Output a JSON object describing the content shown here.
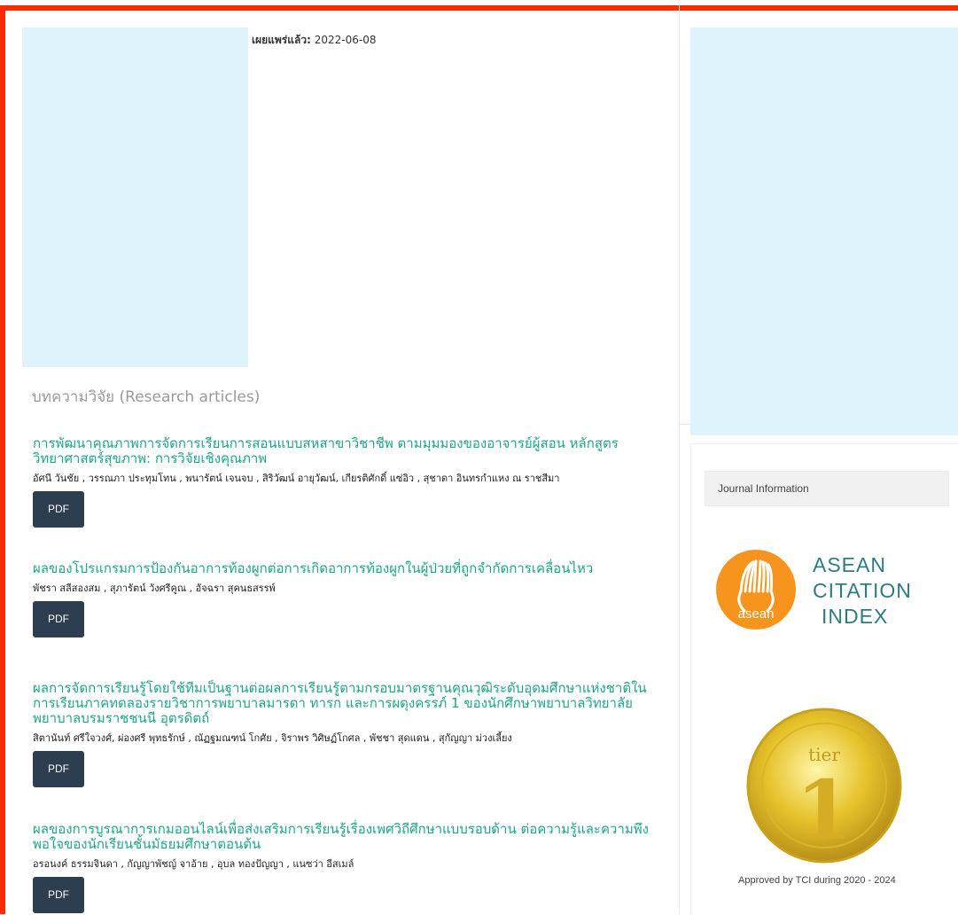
{
  "article_header": {
    "published_label": "เผยแพร่แล้ว:",
    "published_date": "2022-06-08"
  },
  "section": {
    "title": "บทความวิจัย (Research articles)"
  },
  "articles": [
    {
      "title": "การพัฒนาคุณภาพการจัดการเรียนการสอนแบบสหสาขาวิชาชีพ ตามมุมมองของอาจารย์ผู้สอน หลักสูตรวิทยาศาสตร์สุขภาพ: การวิจัยเชิงคุณภาพ",
      "authors": "อัศนี วันชัย , วรรณภา ประทุมโทน , พนารัตน์ เจนจบ , สิริวัฒน์ อายุวัฒน์, เกียรติศักดิ์ แซ่อิว , สุชาดา อินทรกำแหง ณ ราชสีมา",
      "pdf_label": "PDF"
    },
    {
      "title": "ผลของโปรแกรมการป้องกันอาการท้องผูกต่อการเกิดอาการท้องผูกในผู้ป่วยที่ถูกจำกัดการเคลื่อนไหว",
      "authors": "พัชรา สลีสองสม , สุภารัตน์ วังศรีคูณ , อัจฉรา สุคนธสรรพ์",
      "pdf_label": "PDF"
    },
    {
      "title": "ผลการจัดการเรียนรู้โดยใช้ทีมเป็นฐานต่อผลการเรียนรู้ตามกรอบมาตรฐานคุณวุฒิระดับอุดมศึกษาแห่งชาติในการเรียนภาคทดลองรายวิชาการพยาบาลมารดา ทารก และการผดุงครรภ์ 1 ของนักศึกษาพยาบาลวิทยาลัยพยาบาลบรมราชชนนี อุตรดิตถ์",
      "authors": "สิตานันท์ ศรีใจวงศ์, ผ่องศรี พุทธรักษ์ , ณัฏฐมณฑน์ โกศัย , จิราพร วิศิษฏ์โกศล , พัชชา สุดแดน , สุกัญญา ม่วงเลี้ยง",
      "pdf_label": "PDF"
    },
    {
      "title": "ผลของการบูรณาการเกมออนไลน์เพื่อส่งเสริมการเรียนรู้เรื่องเพศวิถีศึกษาแบบรอบด้าน ต่อความรู้และความพึงพอใจของนักเรียนชั้นมัธยมศึกษาตอนต้น",
      "authors": "อรอนงค์ ธรรมจินดา , กัญญาพัชญ์ จาอ้าย , อุบล ทองปัญญา , แนซว่า อีสเมล์",
      "pdf_label": "PDF"
    }
  ],
  "sidebar": {
    "block_title": "Journal Information",
    "asean_logo_text": [
      "ASEAN",
      "CITATION",
      "INDEX"
    ],
    "asean_logo_word": "asean",
    "tier_badge_number": "1",
    "tier_badge_word": "tier",
    "tci_caption": "Approved by TCI during 2020 - 2024"
  },
  "colors": {
    "accent_link": "#1fa58a",
    "button_bg": "#2d3e50",
    "frame_border": "#ff2a00",
    "placeholder": "#dff3fb",
    "asean_orange": "#f7941d",
    "asean_teal": "#2f7c7f",
    "gold": "#e6c22a"
  }
}
